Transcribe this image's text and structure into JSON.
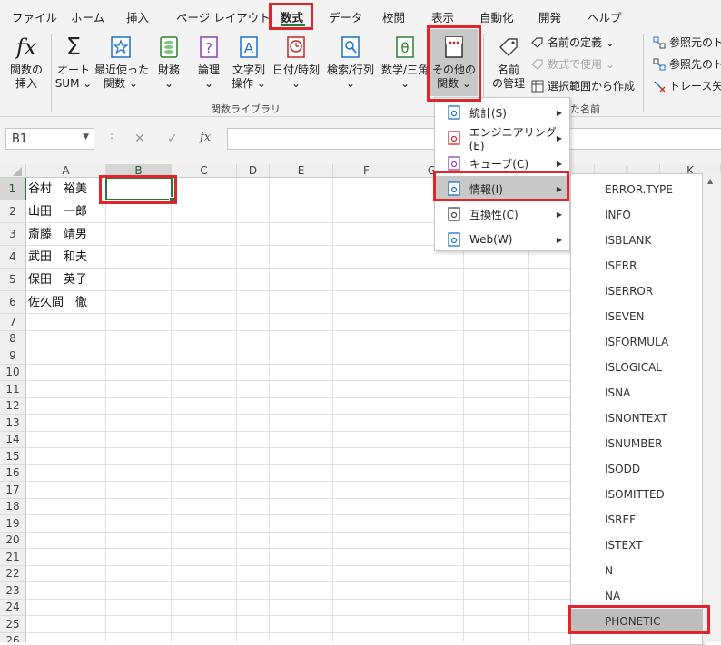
{
  "tabs": [
    "ファイル",
    "ホーム",
    "挿入",
    "ページ レイアウト",
    "数式",
    "データ",
    "校閲",
    "表示",
    "自動化",
    "開発",
    "ヘルプ"
  ],
  "active_tab": "数式",
  "ribbon": {
    "insert_function": [
      "関数の",
      "挿入"
    ],
    "autosum": [
      "オート",
      "SUM ⌄"
    ],
    "recent": [
      "最近使った",
      "関数 ⌄"
    ],
    "financial": [
      "財務",
      "⌄"
    ],
    "logical": [
      "論理",
      "⌄"
    ],
    "text": [
      "文字列",
      "操作 ⌄"
    ],
    "datetime": [
      "日付/時刻",
      "⌄"
    ],
    "lookup": [
      "検索/行列",
      "⌄"
    ],
    "math": [
      "数学/三角",
      "⌄"
    ],
    "more": [
      "その他の",
      "関数 ⌄"
    ],
    "name_manager": [
      "名前",
      "の管理"
    ],
    "define_name": "名前の定義  ⌄",
    "use_in_formula": "数式で使用 ⌄",
    "create_from_selection": "選択範囲から作成",
    "trace_precedents": "参照元のト",
    "trace_dependents": "参照先のト",
    "remove_arrows": "トレース矢印",
    "group_function_library": "関数ライブラリ",
    "group_defined_names": "た名前"
  },
  "formula_bar": {
    "name_box": "B1",
    "fx": "fx",
    "cancel": "✕",
    "enter": "✓"
  },
  "columns": [
    "A",
    "B",
    "C",
    "D",
    "E",
    "F",
    "G",
    "H",
    "I",
    "J",
    "K"
  ],
  "rows": [
    "1",
    "2",
    "3",
    "4",
    "5",
    "6",
    "7",
    "8",
    "9",
    "10",
    "11",
    "12",
    "13",
    "14",
    "15",
    "16",
    "17",
    "18",
    "19",
    "20",
    "21",
    "22",
    "23",
    "24",
    "25",
    "26"
  ],
  "cells_a": [
    "谷村　裕美",
    "山田　一郎",
    "斎藤　靖男",
    "武田　和夫",
    "保田　英子",
    "佐久間　徹"
  ],
  "more_menu": [
    {
      "label": "統計(S)"
    },
    {
      "label": "エンジニアリング(E)"
    },
    {
      "label": "キューブ(C)"
    },
    {
      "label": "情報(I)"
    },
    {
      "label": "互換性(C)"
    },
    {
      "label": "Web(W)"
    }
  ],
  "info_functions": [
    "ERROR.TYPE",
    "INFO",
    "ISBLANK",
    "ISERR",
    "ISERROR",
    "ISEVEN",
    "ISFORMULA",
    "ISLOGICAL",
    "ISNA",
    "ISNONTEXT",
    "ISNUMBER",
    "ISODD",
    "ISOMITTED",
    "ISREF",
    "ISTEXT",
    "N",
    "NA",
    "PHONETIC"
  ],
  "highlighted_function": "PHONETIC",
  "colors": {
    "accent_red": "#e0242a",
    "tab_underline": "#1f7a3f",
    "menu_hover": "#c8c8c8",
    "submenu_selected": "#bdbdbd"
  }
}
